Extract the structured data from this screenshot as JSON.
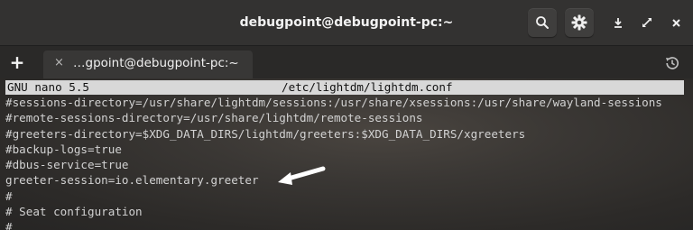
{
  "window": {
    "title": "debugpoint@debugpoint-pc:~",
    "controls": {
      "search_icon": "search-icon",
      "settings_icon": "gear-icon",
      "download_icon": "download-icon",
      "maximize_icon": "maximize-icon",
      "close_icon": "close-icon"
    }
  },
  "tabs": {
    "new_tab_symbol": "+",
    "items": [
      {
        "label": "…gpoint@debugpoint-pc:~",
        "close_symbol": "×"
      }
    ],
    "history_icon": "history-icon"
  },
  "editor": {
    "version": "GNU nano 5.5",
    "file": "/etc/lightdm/lightdm.conf",
    "lines": [
      "#sessions-directory=/usr/share/lightdm/sessions:/usr/share/xsessions:/usr/share/wayland-sessions",
      "#remote-sessions-directory=/usr/share/lightdm/remote-sessions",
      "#greeters-directory=$XDG_DATA_DIRS/lightdm/greeters:$XDG_DATA_DIRS/xgreeters",
      "#backup-logs=true",
      "#dbus-service=true",
      "greeter-session=io.elementary.greeter",
      "#",
      "# Seat configuration",
      "#"
    ]
  },
  "colors": {
    "header_bg": "#333231",
    "terminal_fg": "#d2d2d2",
    "nano_bar_bg": "#d8d8d8",
    "annotation_arrow": "#ffffff"
  }
}
